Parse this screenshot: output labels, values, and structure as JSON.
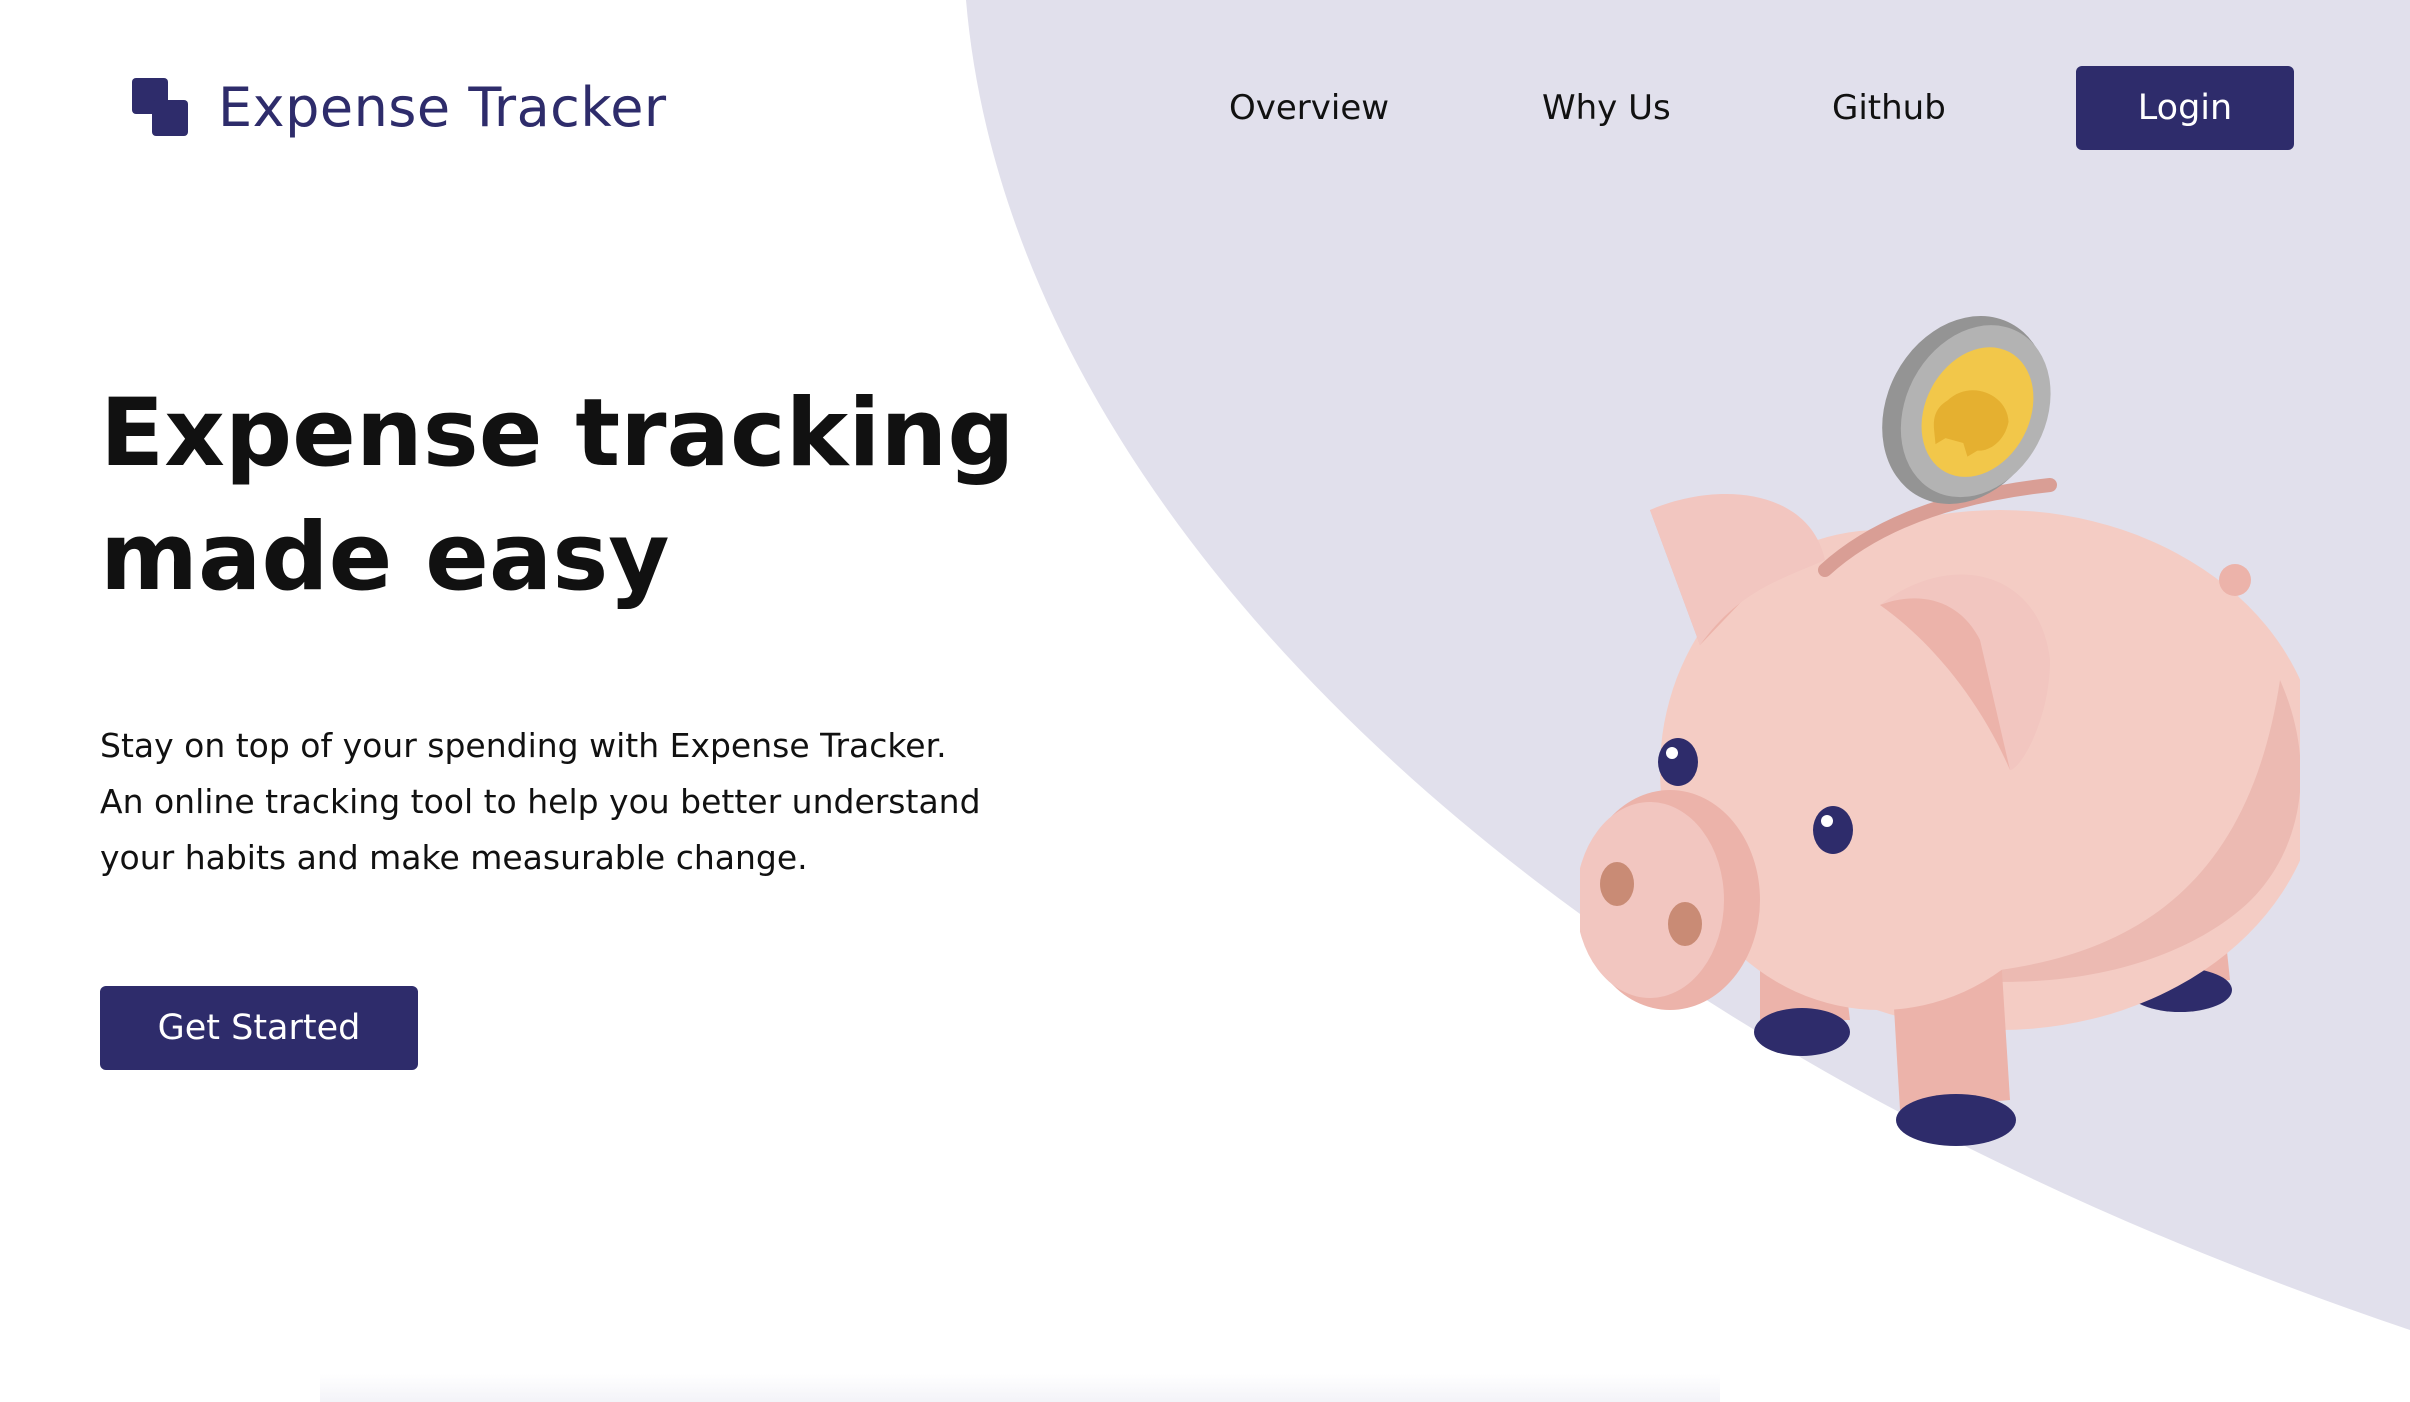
{
  "brand": {
    "title": "Expense Tracker",
    "logo_icon": "stacked-squares-logo-icon",
    "color": "#2e2c6b"
  },
  "nav": {
    "links": [
      {
        "label": "Overview"
      },
      {
        "label": "Why Us"
      },
      {
        "label": "Github"
      }
    ],
    "login_label": "Login"
  },
  "hero": {
    "title": "Expense tracking made easy",
    "subtitle_lines": [
      "Stay on top of your spending with Expense Tracker.",
      "An online tracking tool to help you better understand",
      "your habits and make measurable change."
    ],
    "cta_label": "Get Started"
  },
  "illustration": {
    "name": "piggy-bank-with-coin-icon"
  },
  "colors": {
    "accent": "#2e2c6b",
    "background_shape": "#e1e0ec",
    "text": "#111111",
    "pig": "#f4ccc4",
    "coin": "#f2c74a"
  }
}
